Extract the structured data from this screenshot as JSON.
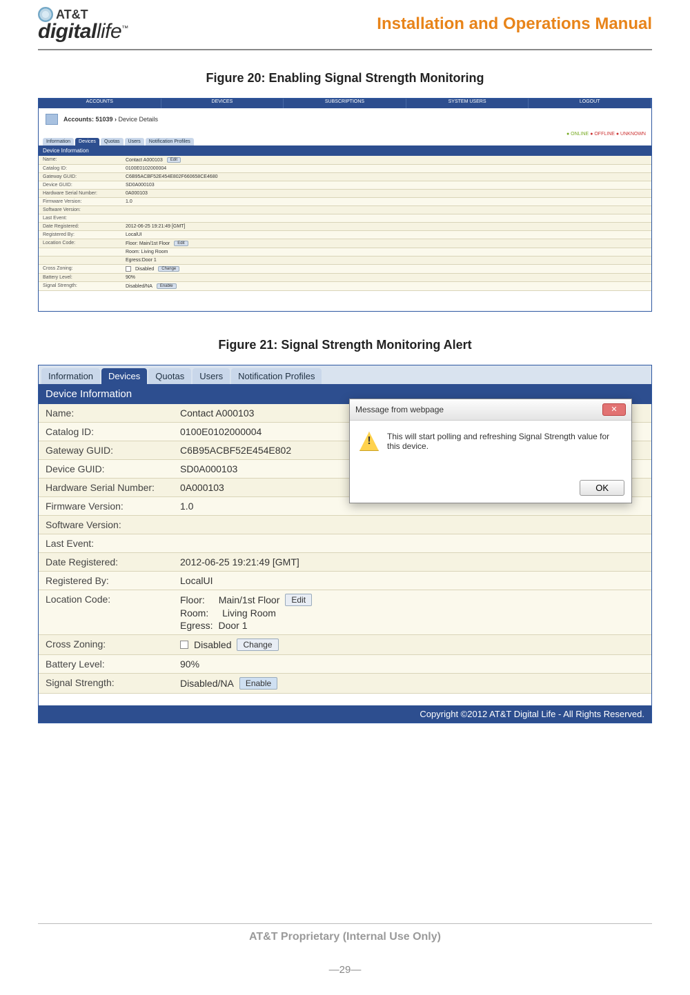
{
  "header": {
    "brand_line1": "AT&T",
    "brand_line2_a": "digital",
    "brand_line2_b": "life",
    "tm": "™",
    "manual_title": "Installation and Operations Manual"
  },
  "figure20": {
    "caption": "Figure 20:  Enabling Signal Strength Monitoring",
    "nav": [
      "ACCOUNTS",
      "DEVICES",
      "SUBSCRIPTIONS",
      "SYSTEM USERS",
      "LOGOUT"
    ],
    "breadcrumb_bold": "Accounts: 51039 ›",
    "breadcrumb_tail": " Device Details",
    "status": {
      "online": "● ONLINE",
      "offline": "● OFFLINE",
      "unknown": "● UNKNOWN"
    },
    "tabs": [
      "Information",
      "Devices",
      "Quotas",
      "Users",
      "Notification Profiles"
    ],
    "section": "Device Information",
    "rows": [
      {
        "label": "Name:",
        "value": "Contact A000103",
        "btn": "Edit"
      },
      {
        "label": "Catalog ID:",
        "value": "0100E0102000004"
      },
      {
        "label": "Gateway GUID:",
        "value": "C6B95ACBF52E454E802F660658CE4680"
      },
      {
        "label": "Device GUID:",
        "value": "SD0A000103"
      },
      {
        "label": "Hardware Serial Number:",
        "value": "0A000103"
      },
      {
        "label": "Firmware Version:",
        "value": "1.0"
      },
      {
        "label": "Software Version:",
        "value": ""
      },
      {
        "label": "Last Event:",
        "value": ""
      },
      {
        "label": "Date Registered:",
        "value": "2012-06-25 19:21:49 [GMT]"
      },
      {
        "label": "Registered By:",
        "value": "LocalUI"
      },
      {
        "label": "Location Code:",
        "value": "Floor:  Main/1st Floor",
        "btn": "Edit",
        "extra1": "Room: Living Room",
        "extra2": "Egress:Door 1"
      },
      {
        "label": "Cross Zoning:",
        "value": "Disabled",
        "checkbox": true,
        "btn": "Change"
      },
      {
        "label": "Battery Level:",
        "value": "90%"
      },
      {
        "label": "Signal Strength:",
        "value": "Disabled/NA",
        "btn": "Enable"
      }
    ]
  },
  "figure21": {
    "caption": "Figure 21: Signal Strength Monitoring Alert",
    "tabs": [
      "Information",
      "Devices",
      "Quotas",
      "Users",
      "Notification Profiles"
    ],
    "section": "Device Information",
    "rows": [
      {
        "label": "Name:",
        "value": "Contact A000103"
      },
      {
        "label": "Catalog ID:",
        "value": "0100E0102000004"
      },
      {
        "label": "Gateway GUID:",
        "value": "C6B95ACBF52E454E802"
      },
      {
        "label": "Device GUID:",
        "value": "SD0A000103"
      },
      {
        "label": "Hardware Serial Number:",
        "value": "0A000103"
      },
      {
        "label": "Firmware Version:",
        "value": "1.0"
      },
      {
        "label": "Software Version:",
        "value": ""
      },
      {
        "label": "Last Event:",
        "value": ""
      },
      {
        "label": "Date Registered:",
        "value": "2012-06-25 19:21:49 [GMT]"
      },
      {
        "label": "Registered By:",
        "value": "LocalUI"
      }
    ],
    "location": {
      "label": "Location Code:",
      "floor_lbl": "Floor:",
      "floor_val": "Main/1st Floor",
      "edit": "Edit",
      "room_lbl": "Room:",
      "room_val": "Living Room",
      "egress_lbl": "Egress:",
      "egress_val": "Door 1"
    },
    "cross": {
      "label": "Cross Zoning:",
      "value": "Disabled",
      "btn": "Change"
    },
    "battery": {
      "label": "Battery Level:",
      "value": "90%"
    },
    "signal": {
      "label": "Signal Strength:",
      "value": "Disabled/NA",
      "btn": "Enable"
    },
    "dialog": {
      "title": "Message from webpage",
      "msg": "This will start polling and refreshing Signal Strength value for this device.",
      "ok": "OK"
    },
    "copyright": "Copyright ©2012 AT&T Digital Life - All Rights Reserved."
  },
  "footer": {
    "proprietary": "AT&T Proprietary (Internal Use Only)",
    "page": "—29—"
  }
}
